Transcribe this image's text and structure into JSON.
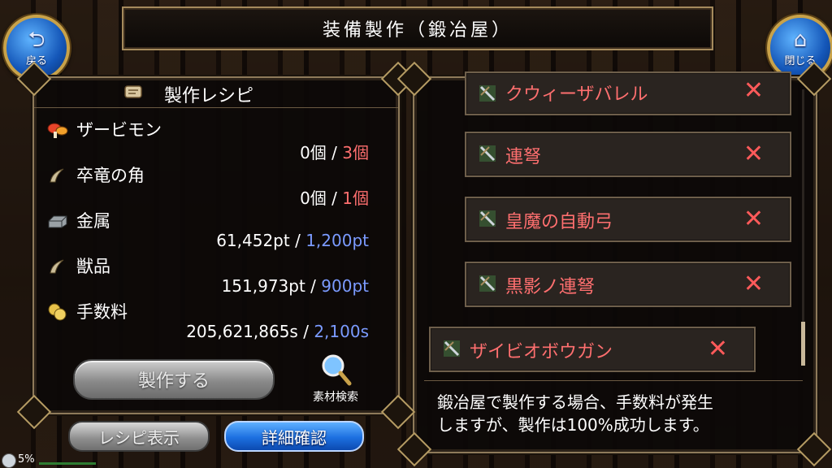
{
  "header": {
    "title": "装備製作（鍛冶屋）",
    "back_label": "戻る",
    "close_label": "閉じる"
  },
  "recipe": {
    "title": "製作レシピ",
    "materials": [
      {
        "name": "ザービモン",
        "have": "0個",
        "sep": "/",
        "need": "3個",
        "need_color": "red",
        "icon": "mushroom-icon"
      },
      {
        "name": "卒竜の角",
        "have": "0個",
        "sep": "/",
        "need": "1個",
        "need_color": "red",
        "icon": "horn-icon"
      },
      {
        "name": "金属",
        "have": "61,452pt",
        "sep": "/",
        "need": "1,200pt",
        "need_color": "blue",
        "icon": "metal-ingot-icon"
      },
      {
        "name": "獣品",
        "have": "151,973pt",
        "sep": "/",
        "need": "900pt",
        "need_color": "blue",
        "icon": "fang-icon"
      },
      {
        "name": "手数料",
        "have": "205,621,865s",
        "sep": "/",
        "need": "2,100s",
        "need_color": "blue",
        "icon": "coins-icon"
      }
    ],
    "make_button": "製作する",
    "search_label": "素材検索"
  },
  "bottom_buttons": {
    "recipe_view": "レシピ表示",
    "detail_check": "詳細確認"
  },
  "status": {
    "percent": "5%",
    "icon": "clock-ring-icon"
  },
  "weapon_list": [
    {
      "name": "クウィーザバレル",
      "icon": "crossbow-icon"
    },
    {
      "name": "連弩",
      "icon": "crossbow-icon"
    },
    {
      "name": "皇魔の自動弓",
      "icon": "crossbow-icon"
    },
    {
      "name": "黒影ノ連弩",
      "icon": "crossbow-icon"
    },
    {
      "name": "ザイビオボウガン",
      "icon": "crossbow-icon"
    }
  ],
  "notice": {
    "line1": "鍛冶屋で製作する場合、手数料が発生",
    "line2": "しますが、製作は100%成功します。"
  },
  "colors": {
    "need_red": "#ff6f6f",
    "need_blue": "#7b9bff",
    "accent_blue": "#1c6fe0",
    "frame_gold": "#c8a24a"
  }
}
